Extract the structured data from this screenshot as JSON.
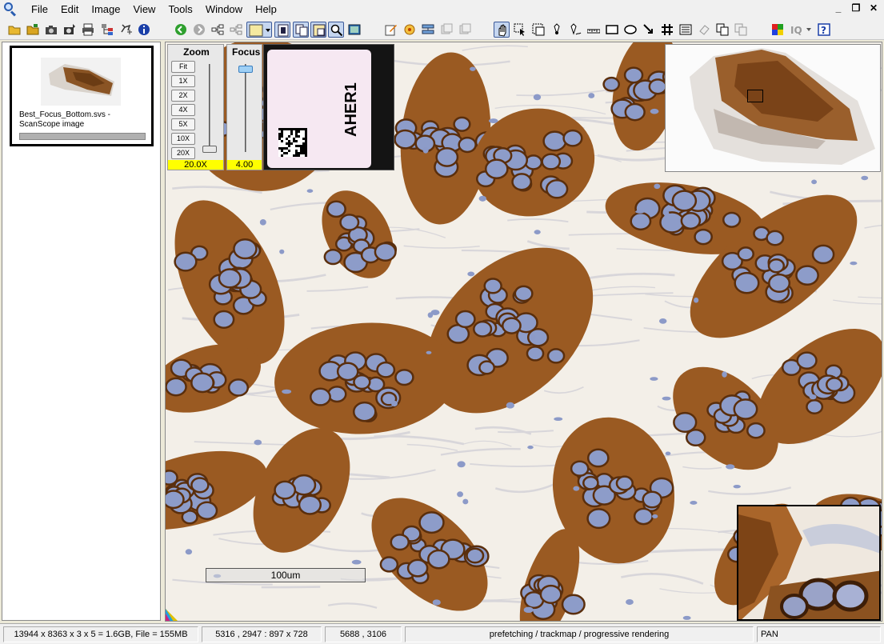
{
  "menu": {
    "file": "File",
    "edit": "Edit",
    "image": "Image",
    "view": "View",
    "tools": "Tools",
    "window": "Window",
    "help": "Help"
  },
  "window_controls": {
    "minimize": "_",
    "restore": "❐",
    "close": "✕"
  },
  "thumbnail": {
    "label": "Best_Focus_Bottom.svs - ScanScope image",
    "progress": 1.0
  },
  "zoom": {
    "title": "Zoom",
    "buttons": [
      "Fit",
      "1X",
      "2X",
      "4X",
      "5X",
      "10X",
      "20X"
    ],
    "value": "20.0X"
  },
  "focus": {
    "title": "Focus",
    "value": "4.00"
  },
  "slide_label": {
    "text": "AHER1"
  },
  "scale_bar": {
    "label": "100um"
  },
  "status": {
    "dimensions": "13944 x 8363 x 3 x 5 = 1.6GB, File = 155MB",
    "coords": "5316 , 2947 : 897 x 728",
    "cursor": "5688 , 3106",
    "message": "prefetching / trackmap / progressive rendering",
    "mode": "PAN"
  },
  "colors": {
    "zoom_value_bg": "#ffff00",
    "stain_dark": "#5a2e0c",
    "stain_brown": "#9a5a22",
    "nucleus_blue": "#8d9cc9",
    "stroma": "#f3efe8"
  },
  "toolbar_icons": [
    "open-folder-icon",
    "save-folder-icon",
    "camera-icon",
    "capture-icon",
    "print-icon",
    "tree-icon",
    "pin-icon",
    "info-icon",
    "back-icon",
    "forward-icon",
    "network-icon",
    "network2-icon",
    "layer-dropdown-icon",
    "single-view-icon",
    "dual-view-icon",
    "sync-view-icon",
    "magnify-icon",
    "thumbnail-icon",
    "annotate-icon",
    "analysis-icon",
    "slide-icon",
    "slides-icon",
    "hand-icon",
    "pan-icon",
    "select-icon",
    "region-icon",
    "pen-icon",
    "freehand-icon",
    "ruler-icon",
    "rectangle-icon",
    "ellipse-icon",
    "arrow-icon",
    "grid-icon",
    "list-icon",
    "eraser-icon",
    "copy-icon",
    "copy2-icon",
    "color-icon",
    "iq-icon",
    "help-icon"
  ]
}
